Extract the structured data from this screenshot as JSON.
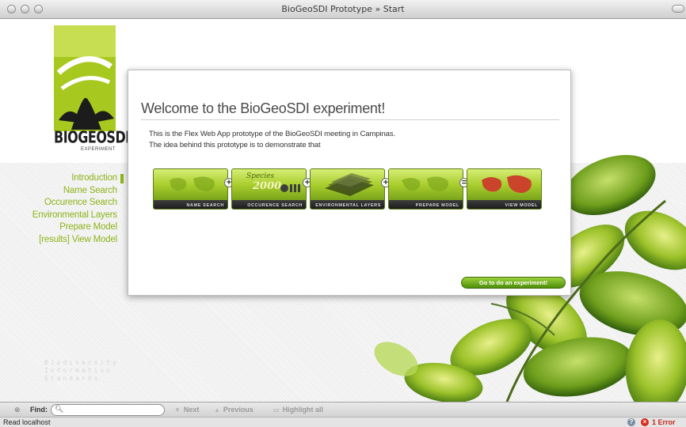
{
  "window": {
    "title": "BioGeoSDI Prototype » Start"
  },
  "logo": {
    "name": "BIOGEOSDI",
    "subtitle": "EXPERIMENT"
  },
  "nav": {
    "items": [
      {
        "label": "Introduction",
        "active": true
      },
      {
        "label": "Name Search",
        "active": false
      },
      {
        "label": "Occurence Search",
        "active": false
      },
      {
        "label": "Environmental Layers",
        "active": false
      },
      {
        "label": "Prepare Model",
        "active": false
      },
      {
        "label": "[results] View Model",
        "active": false
      }
    ],
    "active_color": "#8cb41a"
  },
  "bis_logo": {
    "lines": [
      "Biodiversity",
      "Information",
      "Standards"
    ]
  },
  "dialog": {
    "heading": "Welcome to the BioGeoSDI experiment!",
    "paragraph1": "This is the Flex Web App prototype of the BioGeoSDI meeting in Campinas.",
    "paragraph2": "The idea behind this prototype is to demonstrate that",
    "steps": [
      {
        "label": "NAME SEARCH"
      },
      {
        "label": "OCCURENCE SEARCH",
        "overlay_species": "Species",
        "overlay_year": "2000"
      },
      {
        "label": "ENVIRONMENTAL LAYERS"
      },
      {
        "label": "PREPARE MODEL"
      },
      {
        "label": "VIEW MODEL"
      }
    ],
    "operators": [
      "+",
      "+",
      "+",
      "="
    ],
    "go_button": "Go to do an experiment!"
  },
  "findbar": {
    "label": "Find:",
    "value": "",
    "next": "Next",
    "previous": "Previous",
    "highlight": "Highlight all"
  },
  "statusbar": {
    "status": "Read localhost",
    "errors": "1 Error"
  },
  "colors": {
    "accent": "#8cb41a",
    "button": "#5a9a12",
    "error": "#d42a1c"
  }
}
